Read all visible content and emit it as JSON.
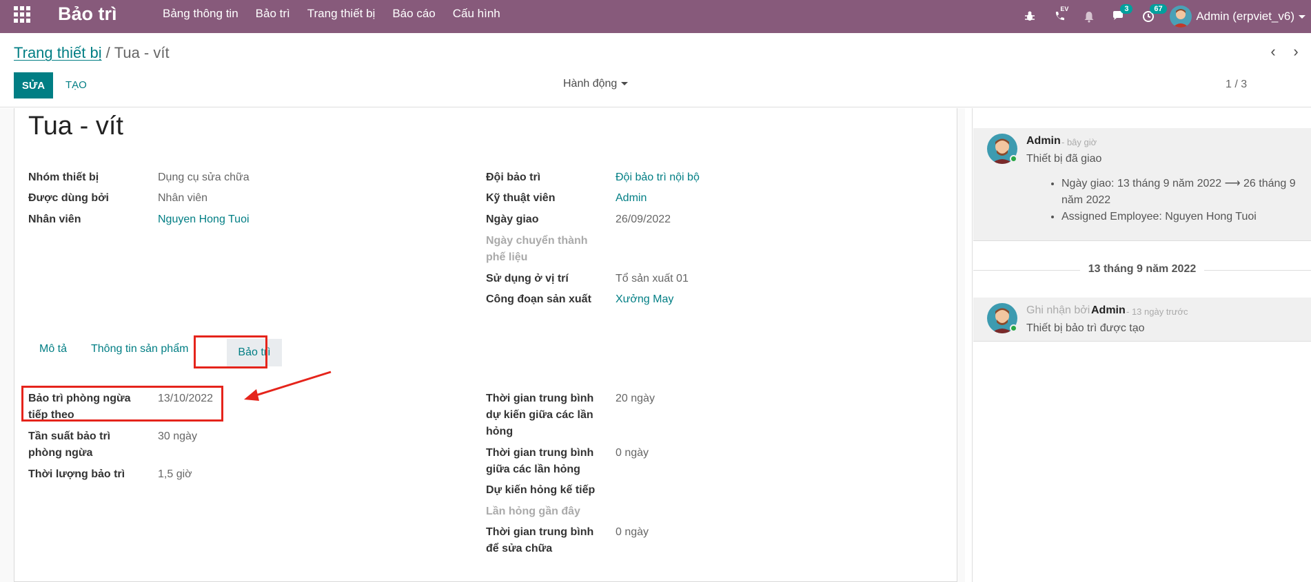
{
  "topbar": {
    "app_title": "Bảo trì",
    "menu": [
      "Bảng thông tin",
      "Bảo trì",
      "Trang thiết bị",
      "Báo cáo",
      "Cấu hình"
    ],
    "chat_badge": "3",
    "activity_badge": "67",
    "phone_label": "EV",
    "user_name": "Admin (erpviet_v6)"
  },
  "control": {
    "breadcrumb_parent": "Trang thiết bị",
    "breadcrumb_separator": "/",
    "breadcrumb_current": "Tua - vít",
    "edit_label": "SỬA",
    "create_label": "TẠO",
    "action_label": "Hành động",
    "pager": "1 / 3"
  },
  "form": {
    "title": "Tua - vít",
    "left_fields": [
      {
        "label": "Nhóm thiết bị",
        "value": "Dụng cụ sửa chữa"
      },
      {
        "label": "Được dùng bởi",
        "value": "Nhân viên"
      },
      {
        "label": "Nhân viên",
        "value": "Nguyen Hong Tuoi"
      }
    ],
    "right_fields": [
      {
        "label": "Đội bảo trì",
        "value": "Đội bảo trì nội bộ"
      },
      {
        "label": "Kỹ thuật viên",
        "value": "Admin"
      },
      {
        "label": "Ngày giao",
        "value": "26/09/2022"
      },
      {
        "label": "Ngày chuyển thành phế liệu",
        "value": ""
      },
      {
        "label": "Sử dụng ở vị trí",
        "value": "Tổ sản xuất 01"
      },
      {
        "label": "Công đoạn sản xuất",
        "value": "Xưởng May"
      }
    ],
    "tabs": [
      "Mô tả",
      "Thông tin sản phẩm",
      "Bảo trì"
    ],
    "maint_left": [
      {
        "label": "Bảo trì phòng ngừa tiếp theo",
        "value": "13/10/2022"
      },
      {
        "label": "Tần suất bảo trì phòng ngừa",
        "value": "30  ngày"
      },
      {
        "label": "Thời lượng bảo trì",
        "value": "1,5  giờ"
      }
    ],
    "maint_right": [
      {
        "label": "Thời gian trung bình dự kiến giữa các lần hỏng",
        "value": "20  ngày"
      },
      {
        "label": "Thời gian trung bình giữa các lần hỏng",
        "value": "0  ngày"
      },
      {
        "label": "Dự kiến hỏng kế tiếp",
        "value": ""
      },
      {
        "label": "Lần hỏng gần đây",
        "value": ""
      },
      {
        "label": "Thời gian trung bình để sửa chữa",
        "value": "0  ngày"
      }
    ]
  },
  "chatter": {
    "msg1": {
      "author": "Admin",
      "time": "- bây giờ",
      "text": "Thiết bị đã giao",
      "bullets": [
        "Ngày giao: 13 tháng 9 năm 2022 ⟶ 26 tháng 9 năm 2022",
        "Assigned Employee: Nguyen Hong Tuoi"
      ]
    },
    "date_separator": "13 tháng 9 năm 2022",
    "msg2": {
      "prefix": "Ghi nhận bởi",
      "author": "Admin",
      "time": "- 13 ngày trước",
      "text": "Thiết bị bảo trì được tạo"
    }
  }
}
